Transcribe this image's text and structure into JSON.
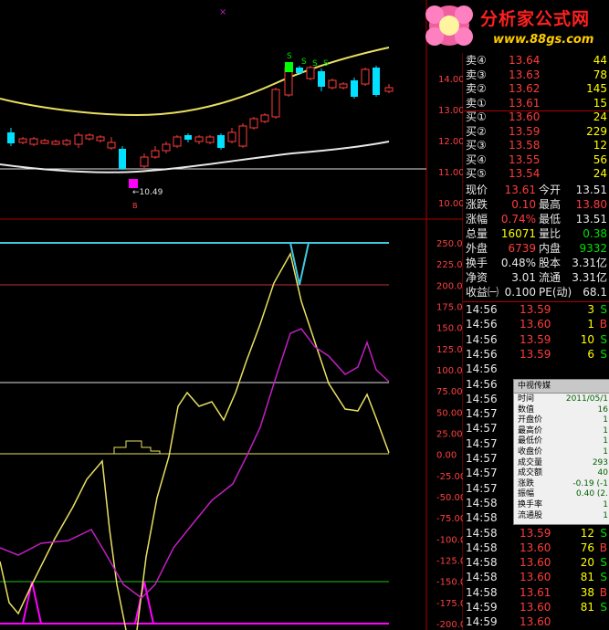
{
  "brand": {
    "name": "分析家公式网",
    "url": "www.88gs.com"
  },
  "top_marker": "×",
  "price_axis": [
    "14.00",
    "13.00",
    "12.00",
    "11.00",
    "10.00"
  ],
  "indicator_axis": [
    "250.00",
    "225.00",
    "200.00",
    "175.00",
    "150.00",
    "125.00",
    "100.00",
    "75.00",
    "50.00",
    "25.00",
    "0.00",
    "-25.00",
    "-50.00",
    "-75.00",
    "-100.00",
    "-125.00",
    "-150.00",
    "-175.00",
    "-200.00"
  ],
  "low_label": "←10.49",
  "b_marker": "B",
  "s_marker": "S",
  "quotes": {
    "asks": [
      {
        "label": "卖④",
        "price": "13.64",
        "vol": "44"
      },
      {
        "label": "卖③",
        "price": "13.63",
        "vol": "78"
      },
      {
        "label": "卖②",
        "price": "13.62",
        "vol": "145"
      },
      {
        "label": "卖①",
        "price": "13.61",
        "vol": "15"
      }
    ],
    "bids": [
      {
        "label": "买①",
        "price": "13.60",
        "vol": "24"
      },
      {
        "label": "买②",
        "price": "13.59",
        "vol": "229"
      },
      {
        "label": "买③",
        "price": "13.58",
        "vol": "12"
      },
      {
        "label": "买④",
        "price": "13.55",
        "vol": "56"
      },
      {
        "label": "买⑤",
        "price": "13.54",
        "vol": "24"
      }
    ]
  },
  "stats": [
    {
      "k1": "现价",
      "v1": "13.61",
      "k2": "今开",
      "v2": "13.51"
    },
    {
      "k1": "涨跌",
      "v1": "0.10",
      "k2": "最高",
      "v2": "13.80"
    },
    {
      "k1": "涨幅",
      "v1": "0.74%",
      "k2": "最低",
      "v2": "13.51"
    },
    {
      "k1": "总量",
      "v1": "16071",
      "k2": "量比",
      "v2": "0.38"
    },
    {
      "k1": "外盘",
      "v1": "6739",
      "k2": "内盘",
      "v2": "9332"
    },
    {
      "k1": "换手",
      "v1": "0.48%",
      "k2": "股本",
      "v2": "3.31亿"
    },
    {
      "k1": "净资",
      "v1": "3.01",
      "k2": "流通",
      "v2": "3.31亿"
    },
    {
      "k1": "收益㈠",
      "v1": "0.100",
      "k2": "PE(动)",
      "v2": "68.1"
    }
  ],
  "ticks": [
    {
      "t": "14:56",
      "p": "13.59",
      "v": "3",
      "d": "S"
    },
    {
      "t": "14:56",
      "p": "13.60",
      "v": "1",
      "d": "B"
    },
    {
      "t": "14:56",
      "p": "13.59",
      "v": "10",
      "d": "S"
    },
    {
      "t": "14:56",
      "p": "13.59",
      "v": "6",
      "d": "S"
    },
    {
      "t": "14:56",
      "p": "",
      "v": "",
      "d": ""
    },
    {
      "t": "14:56",
      "p": "",
      "v": "",
      "d": ""
    },
    {
      "t": "14:56",
      "p": "",
      "v": "",
      "d": ""
    },
    {
      "t": "14:57",
      "p": "",
      "v": "",
      "d": ""
    },
    {
      "t": "14:57",
      "p": "",
      "v": "",
      "d": ""
    },
    {
      "t": "14:57",
      "p": "",
      "v": "",
      "d": ""
    },
    {
      "t": "14:57",
      "p": "",
      "v": "",
      "d": ""
    },
    {
      "t": "14:57",
      "p": "",
      "v": "",
      "d": ""
    },
    {
      "t": "14:57",
      "p": "",
      "v": "",
      "d": ""
    },
    {
      "t": "14:58",
      "p": "",
      "v": "",
      "d": ""
    },
    {
      "t": "14:58",
      "p": "",
      "v": "",
      "d": ""
    },
    {
      "t": "14:58",
      "p": "13.59",
      "v": "12",
      "d": "S"
    },
    {
      "t": "14:58",
      "p": "13.60",
      "v": "76",
      "d": "B"
    },
    {
      "t": "14:58",
      "p": "13.60",
      "v": "20",
      "d": "S"
    },
    {
      "t": "14:58",
      "p": "13.60",
      "v": "81",
      "d": "S"
    },
    {
      "t": "14:58",
      "p": "13.61",
      "v": "38",
      "d": "B"
    },
    {
      "t": "14:59",
      "p": "13.60",
      "v": "81",
      "d": "S"
    },
    {
      "t": "14:59",
      "p": "13.60",
      "v": "",
      "d": ""
    }
  ],
  "popup": {
    "title": "中视传媒",
    "rows": [
      {
        "k": "时间",
        "v": "2011/05/1"
      },
      {
        "k": "数值",
        "v": "16"
      },
      {
        "k": "开盘价",
        "v": "1"
      },
      {
        "k": "最高价",
        "v": "1"
      },
      {
        "k": "最低价",
        "v": "1"
      },
      {
        "k": "收盘价",
        "v": "1"
      },
      {
        "k": "成交量",
        "v": "293"
      },
      {
        "k": "成交额",
        "v": "40"
      },
      {
        "k": "涨跌",
        "v": "-0.19 (-1"
      },
      {
        "k": "振幅",
        "v": "0.40 (2."
      },
      {
        "k": "换手率",
        "v": "1"
      },
      {
        "k": "流通股",
        "v": "1"
      }
    ]
  },
  "colors": {
    "up": "#ff3c3c",
    "down": "#00e0ff",
    "ma_yellow": "#e8e060",
    "ma_white": "#e8e8e8",
    "pink": "#c020c0",
    "magenta_box": "#ff00ff",
    "green_box": "#00ff00",
    "cyan_line": "#40c8e0"
  }
}
